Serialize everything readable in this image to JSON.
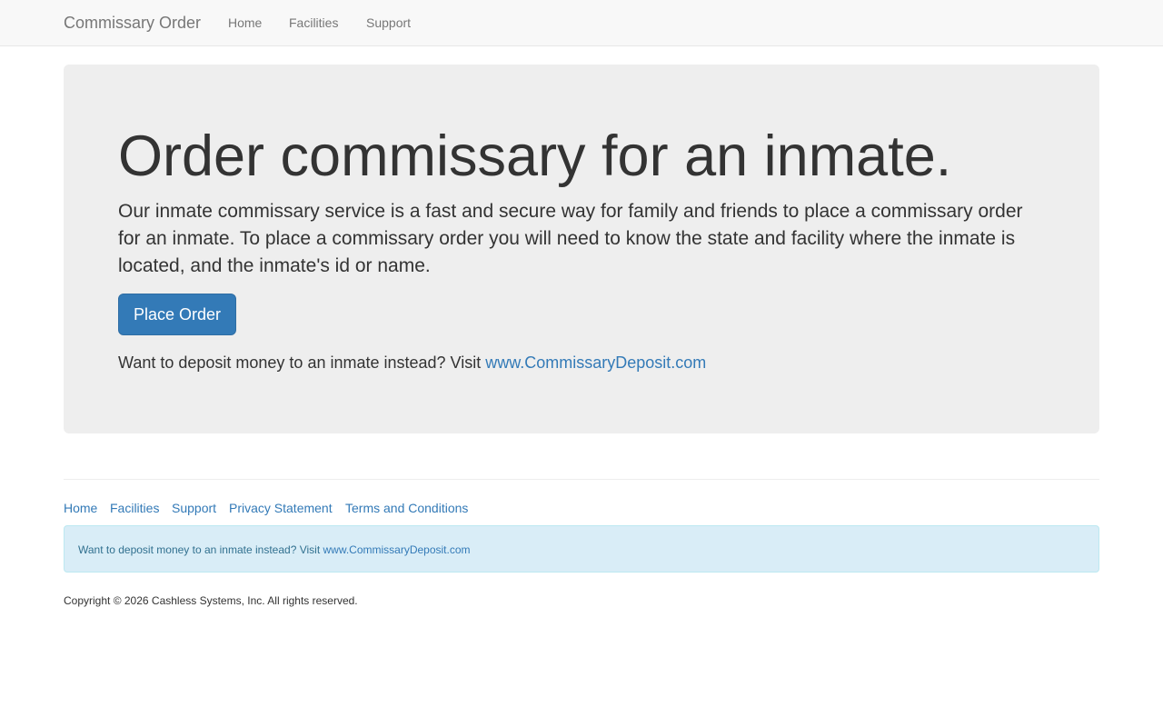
{
  "navbar": {
    "brand": "Commissary Order",
    "links": [
      "Home",
      "Facilities",
      "Support"
    ]
  },
  "hero": {
    "title": "Order commissary for an inmate.",
    "text": "Our inmate commissary service is a fast and secure way for family and friends to place a commissary order for an inmate. To place a commissary order you will need to know the state and facility where the inmate is located, and the inmate's id or name.",
    "button_label": "Place Order",
    "deposit_prefix": "Want to deposit money to an inmate instead? Visit ",
    "deposit_link": "www.CommissaryDeposit.com"
  },
  "footer": {
    "links": [
      "Home",
      "Facilities",
      "Support",
      "Privacy Statement",
      "Terms and Conditions"
    ],
    "alert_prefix": "Want to deposit money to an inmate instead? Visit ",
    "alert_link": "www.CommissaryDeposit.com",
    "copyright": "Copyright © 2026 Cashless Systems, Inc. All rights reserved."
  },
  "colors": {
    "navbar_bg": "#f8f8f8",
    "jumbotron_bg": "#eeeeee",
    "primary": "#337ab7",
    "alert_bg": "#d9edf7"
  }
}
